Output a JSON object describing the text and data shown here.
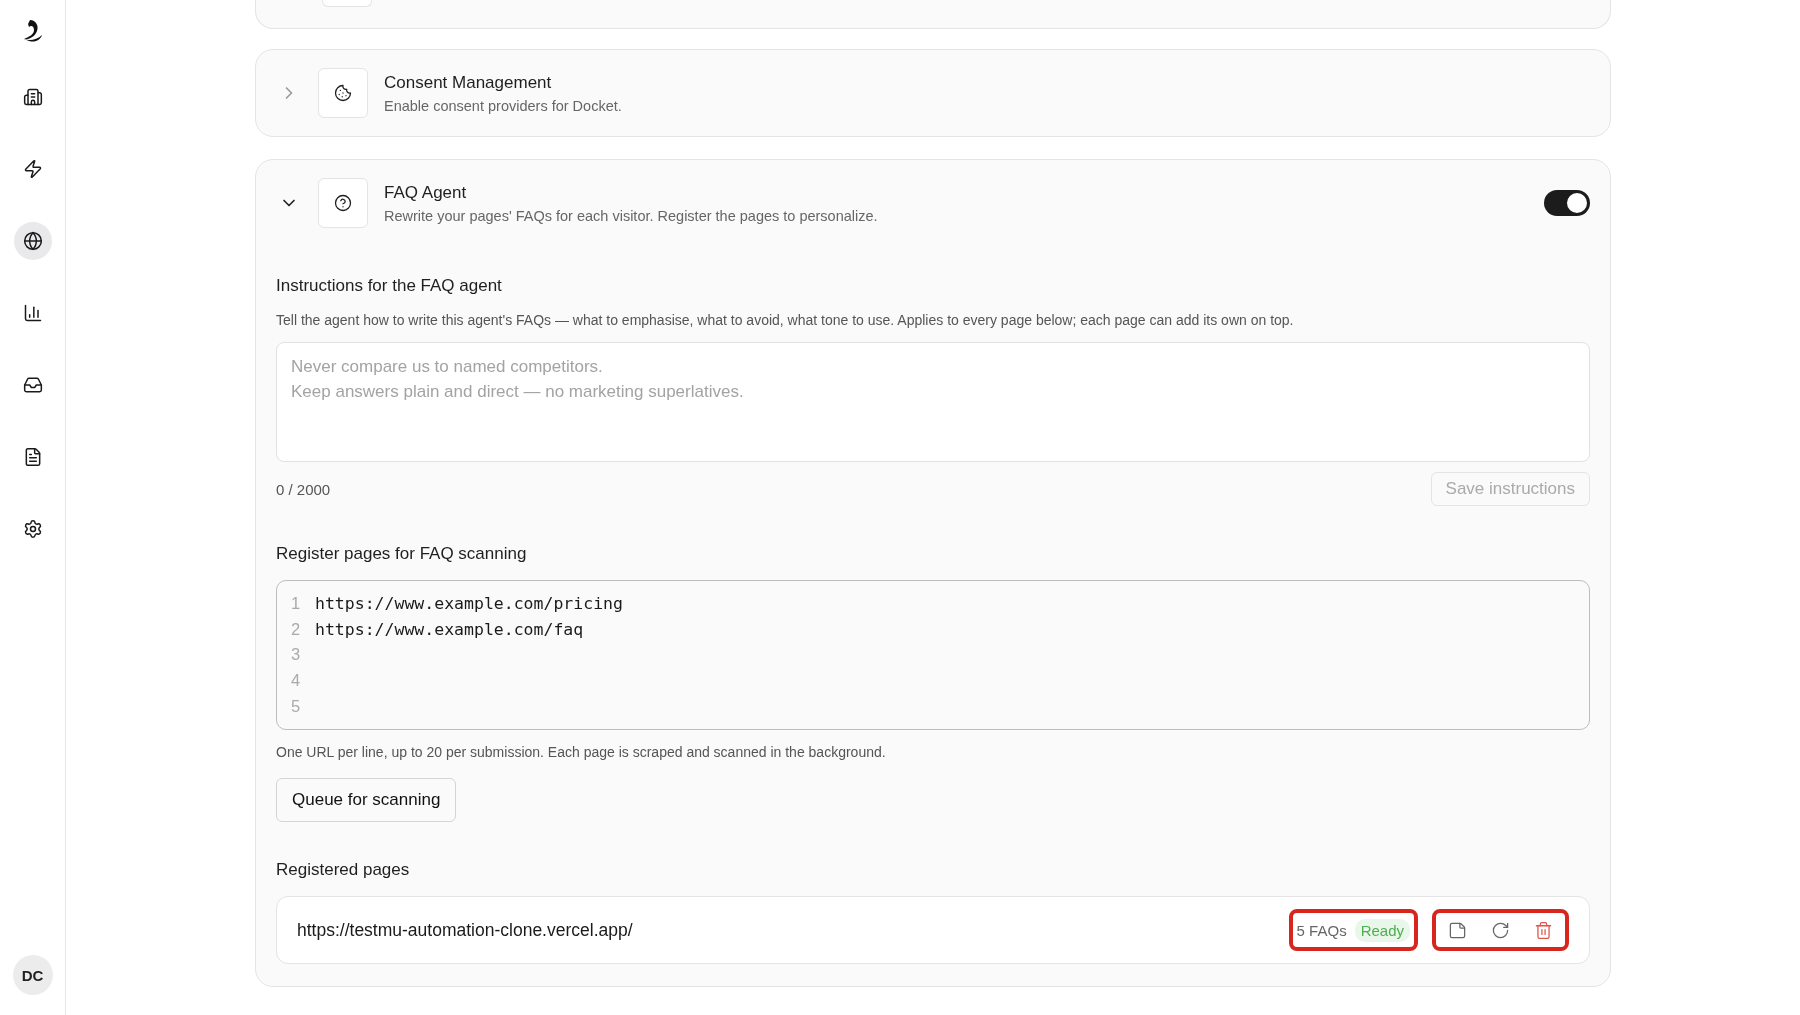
{
  "sidebar": {
    "items": [
      {
        "kind": "building",
        "selected": false
      },
      {
        "kind": "lightning",
        "selected": false
      },
      {
        "kind": "globe",
        "selected": true
      },
      {
        "kind": "chart",
        "selected": false
      },
      {
        "kind": "inbox",
        "selected": false
      },
      {
        "kind": "document",
        "selected": false
      },
      {
        "kind": "settings",
        "selected": false
      }
    ],
    "avatar": {
      "initials": "DC"
    }
  },
  "sections": [
    {
      "kind": "consent",
      "title": "Consent Management",
      "description": "Enable consent providers for Docket.",
      "expanded": false
    },
    {
      "kind": "faq",
      "title": "FAQ Agent",
      "description": "Rewrite your pages' FAQs for each visitor. Register the pages to personalize.",
      "expanded": true,
      "enabled": true
    }
  ],
  "faq_agent": {
    "instructions": {
      "heading": "Instructions for the FAQ agent",
      "description": "Tell the agent how to write this agent's FAQs — what to emphasise, what to avoid, what tone to use. Applies to every page below; each page can add its own on top.",
      "placeholder": "Never compare us to named competitors.\nKeep answers plain and direct — no marketing superlatives.",
      "counter": "0 / 2000",
      "save_button": {
        "label": "Save instructions",
        "disabled": true
      }
    },
    "register": {
      "heading": "Register pages for FAQ scanning",
      "lines": [
        {
          "number": "1",
          "url": "https://www.example.com/pricing"
        },
        {
          "number": "2",
          "url": "https://www.example.com/faq"
        },
        {
          "number": "3"
        },
        {
          "number": "4"
        },
        {
          "number": "5"
        }
      ],
      "hint": "One URL per line, up to 20 per submission. Each page is scraped and scanned in the background.",
      "queue_button": "Queue for scanning"
    },
    "registered": {
      "heading": "Registered pages",
      "pages": [
        {
          "url": "https://testmu-automation-clone.vercel.app/",
          "count": "5 FAQs",
          "status": "Ready",
          "highlighted": true
        }
      ]
    }
  }
}
